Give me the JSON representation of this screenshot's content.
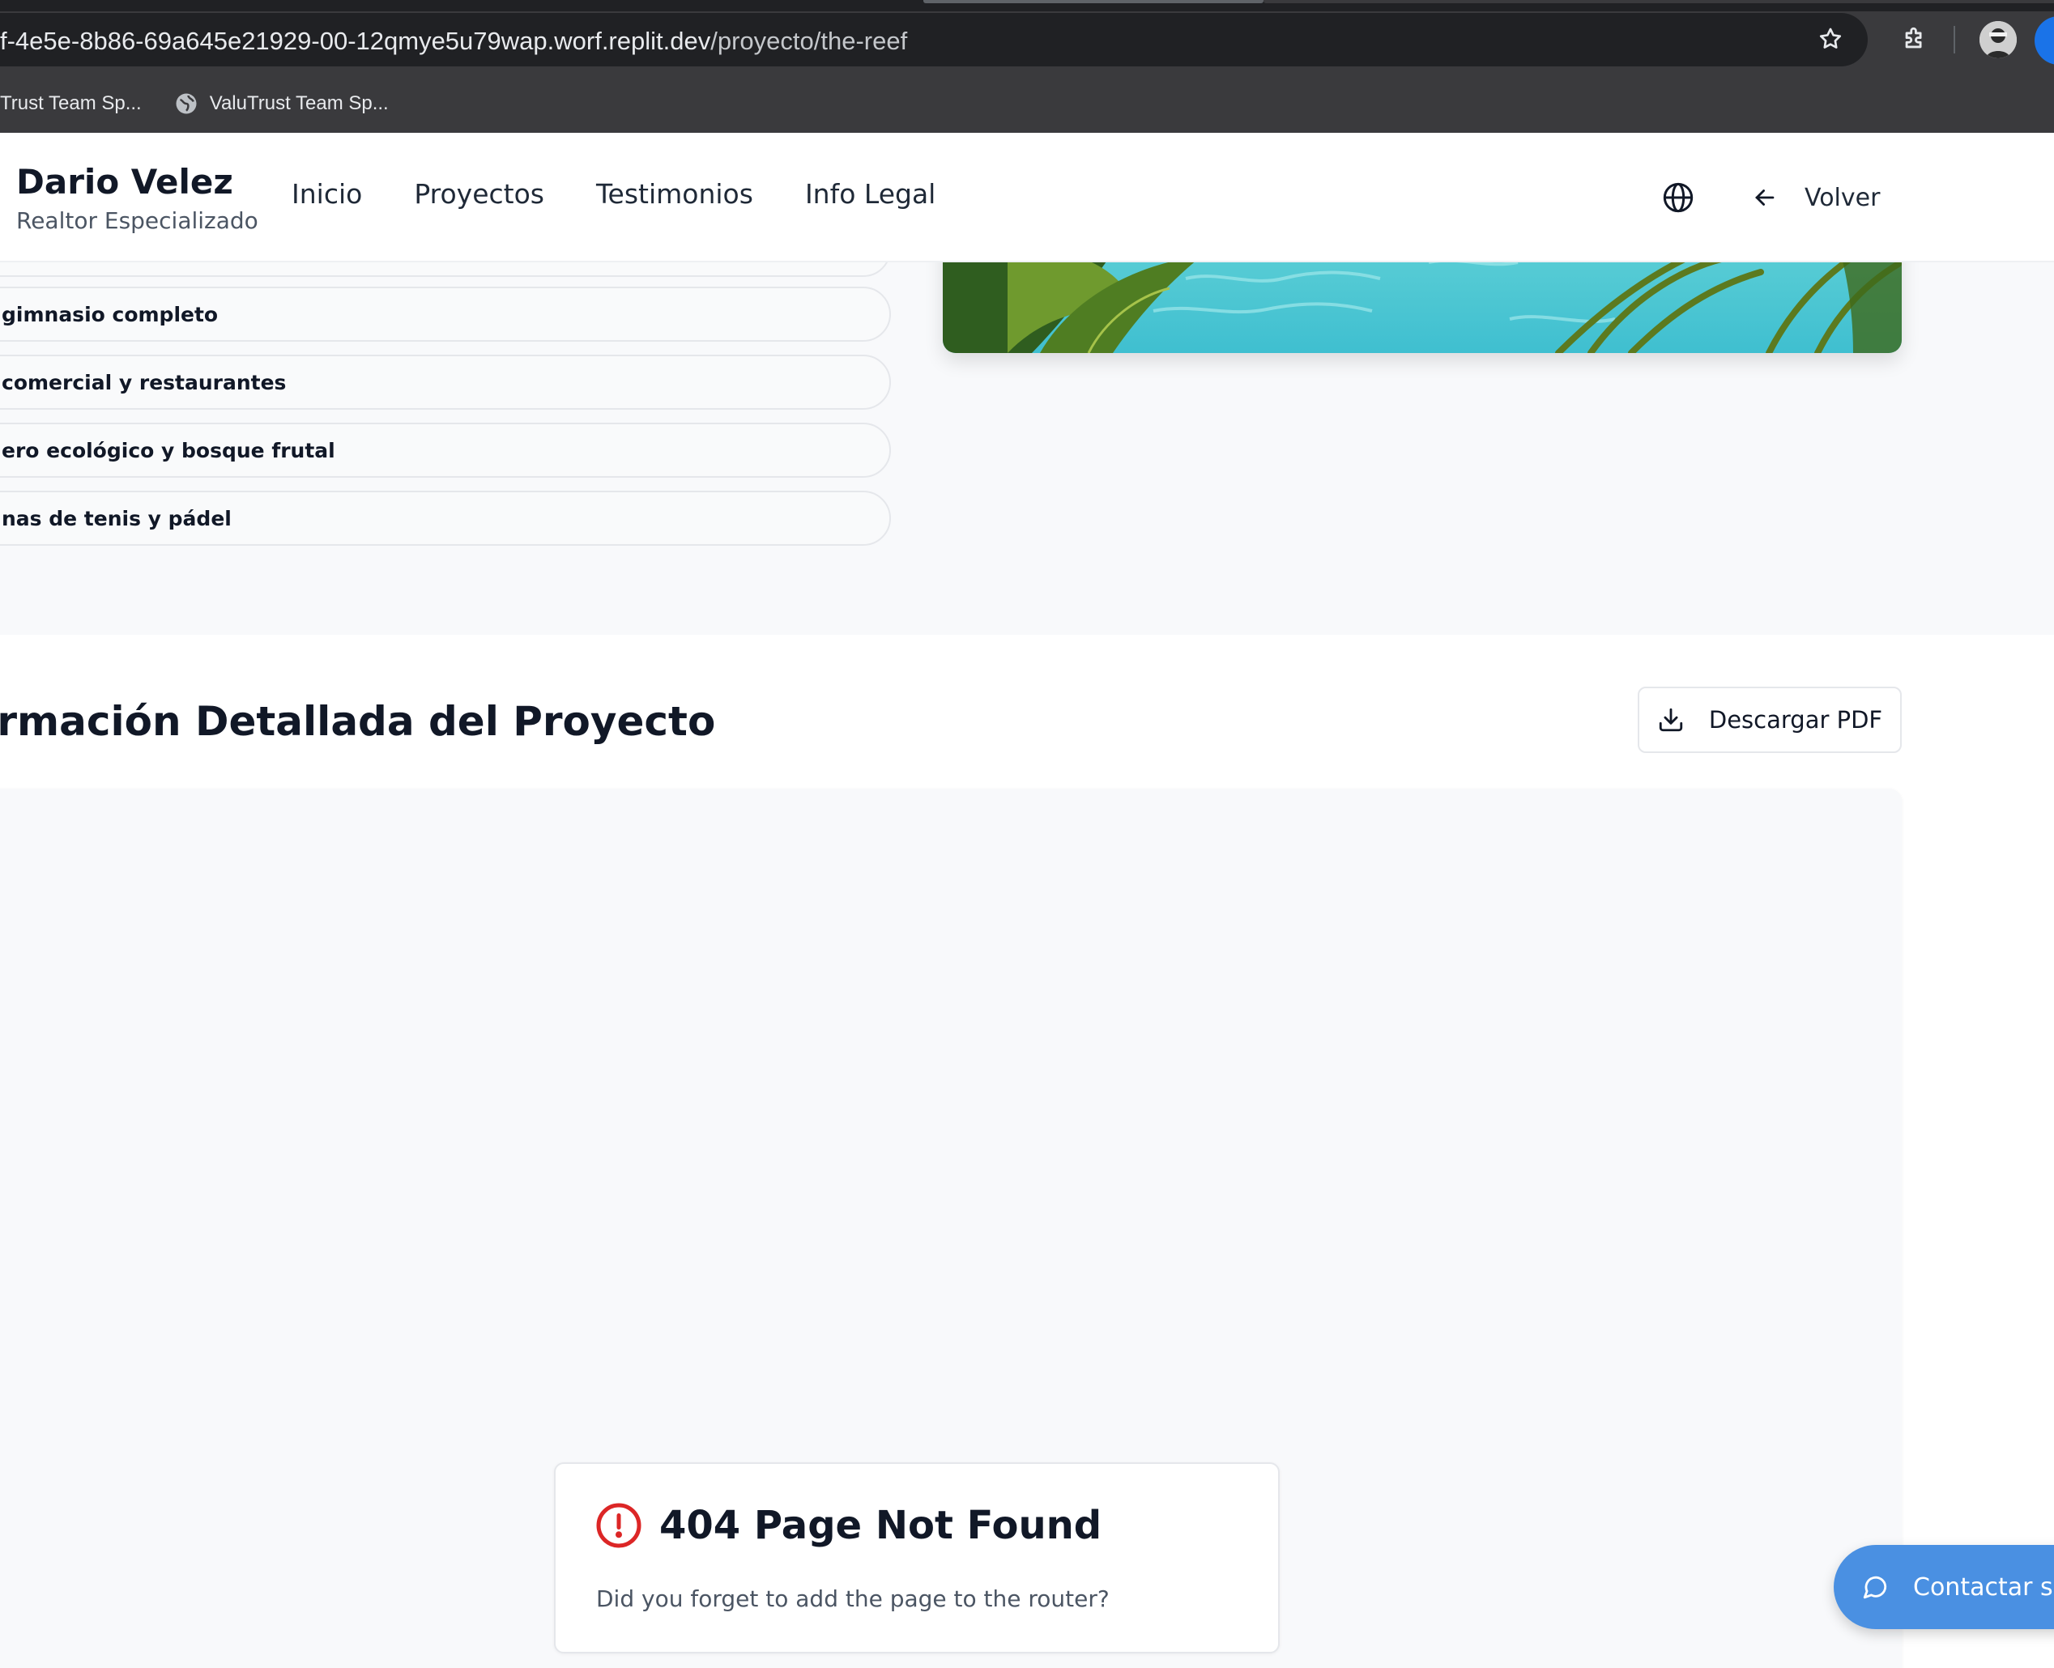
{
  "browser": {
    "url_host": "f-4e5e-8b86-69a645e21929-00-12qmye5u79wap.worf.replit.dev",
    "url_path": "/proyecto/the-reef",
    "bookmarks": [
      {
        "label": "Trust Team Sp..."
      },
      {
        "label": "ValuTrust Team Sp..."
      }
    ]
  },
  "header": {
    "brand_name": "Dario Velez",
    "brand_subtitle": "Realtor Especializado",
    "nav": [
      "Inicio",
      "Proyectos",
      "Testimonios",
      "Info Legal"
    ],
    "back_label": "Volver"
  },
  "amenities": [
    "gimnasio completo",
    "comercial y restaurantes",
    "ero ecológico y bosque frutal",
    "nas de tenis y pádel"
  ],
  "detail": {
    "title": "ormación Detallada del Proyecto",
    "download_label": "Descargar PDF"
  },
  "not_found": {
    "title": "404 Page Not Found",
    "message": "Did you forget to add the page to the router?"
  },
  "contact": {
    "label": "Contactar sol"
  },
  "colors": {
    "accent": "#4a90e2",
    "error": "#dc2626",
    "text": "#111827"
  }
}
